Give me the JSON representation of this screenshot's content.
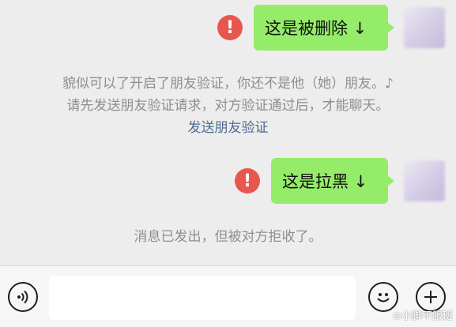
{
  "messages": [
    {
      "text": "这是被删除 ↓",
      "status_icon": "exclamation-icon"
    },
    {
      "text": "这是拉黑 ↓",
      "status_icon": "exclamation-icon"
    }
  ],
  "system_notices": {
    "friend_check_line1": "貌似可以了开启了朋友验证，你还不是他（她）朋友。♪",
    "friend_check_line2": "请先发送朋友验证请求，对方验证通过后，才能聊天。",
    "send_verification_link": "发送朋友验证",
    "rejected": "消息已发出，但被对方拒收了。"
  },
  "input_bar": {
    "voice_icon": "voice-icon",
    "emoji_icon": "emoji-icon",
    "more_icon": "plus-icon"
  },
  "watermark": "⊙小脚不服班",
  "colors": {
    "background": "#ededed",
    "bubble": "#95ec69",
    "error": "#e8574f",
    "link": "#4f6a92",
    "notice_text": "#8e8e8e"
  }
}
